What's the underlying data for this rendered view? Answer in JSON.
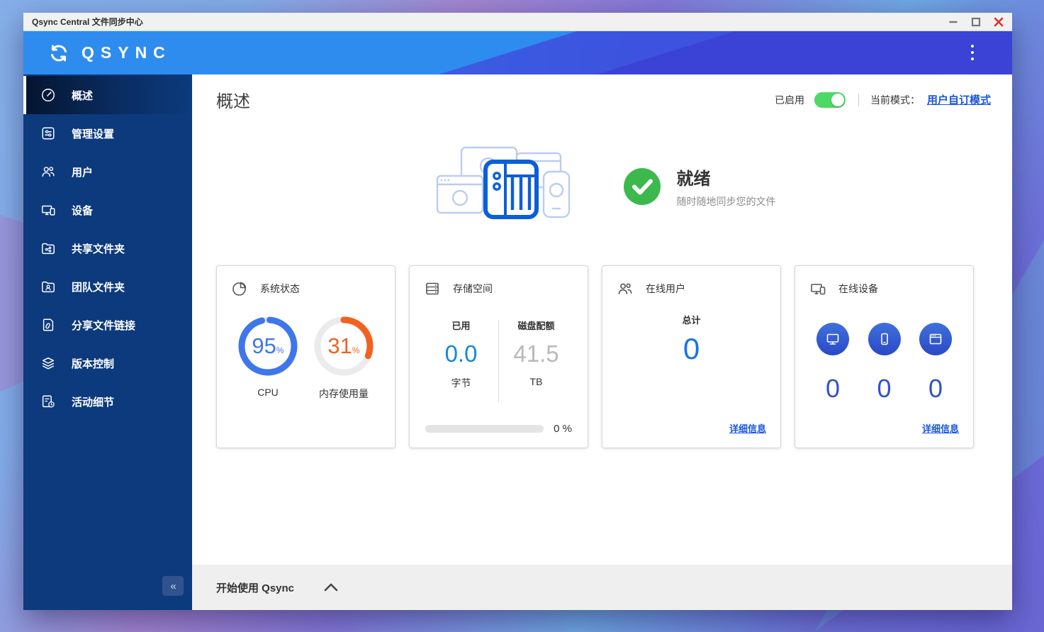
{
  "titlebar": {
    "title": "Qsync Central 文件同步中心",
    "controls": {
      "minimize": "minimize",
      "maximize": "maximize",
      "close": "close"
    }
  },
  "header": {
    "logo_text": "QSYNC"
  },
  "sidebar": {
    "items": [
      {
        "label": "概述",
        "icon": "gauge-icon",
        "active": true
      },
      {
        "label": "管理设置",
        "icon": "settings-sliders-icon",
        "active": false
      },
      {
        "label": "用户",
        "icon": "users-icon",
        "active": false
      },
      {
        "label": "设备",
        "icon": "devices-icon",
        "active": false
      },
      {
        "label": "共享文件夹",
        "icon": "shared-folder-icon",
        "active": false
      },
      {
        "label": "团队文件夹",
        "icon": "team-folder-icon",
        "active": false
      },
      {
        "label": "分享文件链接",
        "icon": "file-link-icon",
        "active": false
      },
      {
        "label": "版本控制",
        "icon": "layers-icon",
        "active": false
      },
      {
        "label": "活动细节",
        "icon": "activity-log-icon",
        "active": false
      }
    ],
    "collapse_icon": "«"
  },
  "main": {
    "title": "概述",
    "enabled_toggle": {
      "label": "已启用",
      "state": "on"
    },
    "mode": {
      "label": "当前模式：",
      "value": "用户自订模式"
    },
    "hero": {
      "status_title": "就绪",
      "status_subtitle": "随时随地同步您的文件"
    },
    "cards": {
      "system": {
        "title": "系统状态",
        "gauges": [
          {
            "label": "CPU",
            "value": 95,
            "unit": "%",
            "color": "#3e76ec",
            "track": "#e9e9e9"
          },
          {
            "label": "内存使用量",
            "value": 31,
            "unit": "%",
            "color": "#f4601f",
            "track": "#ebebeb"
          }
        ]
      },
      "storage": {
        "title": "存储空间",
        "used_label": "已用",
        "used_value": "0.0",
        "used_unit": "字节",
        "quota_label": "磁盘配额",
        "quota_value": "41.5",
        "quota_unit": "TB",
        "progress_percent": 0,
        "progress_label": "0 %"
      },
      "online_users": {
        "title": "在线用户",
        "total_label": "总计",
        "total_value": "0",
        "details_label": "详细信息"
      },
      "online_devices": {
        "title": "在线设备",
        "counts": [
          {
            "type": "desktop",
            "value": "0"
          },
          {
            "type": "mobile",
            "value": "0"
          },
          {
            "type": "browser",
            "value": "0"
          }
        ],
        "details_label": "详细信息"
      }
    },
    "footer": {
      "label": "开始使用 Qsync"
    }
  },
  "colors": {
    "accent_blue": "#2f8bef",
    "indigo": "#3a41d6",
    "sidebar_navy": "#0c3a7d",
    "toggle_green": "#4cd964",
    "check_green": "#3cb94c",
    "link_blue": "#1a56db",
    "used_blue": "#1787d8",
    "quota_gray": "#b9b9b9",
    "cpu_blue": "#3e76ec",
    "memory_orange": "#f4601f",
    "device_count_blue": "#3452c8",
    "users_total_blue": "#1a73e8"
  }
}
